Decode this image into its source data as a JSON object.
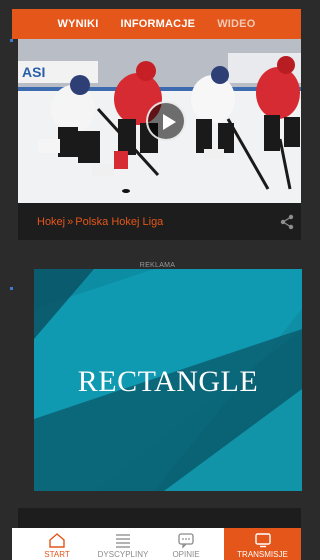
{
  "tabs": [
    "WYNIKI",
    "INFORMACJE",
    "WIDEO"
  ],
  "video": {
    "breadcrumb_sport": "Hokej",
    "breadcrumb_sep": "»",
    "breadcrumb_league": "Polska Hokej Liga"
  },
  "ad": {
    "label": "REKLAMA",
    "text": "RECTANGLE"
  },
  "nav": {
    "start": "START",
    "dyscypliny": "DYSCYPLINY",
    "opinie": "OPINIE",
    "transmisje": "TRANSMISJE"
  },
  "colors": {
    "accent": "#e4561a",
    "background": "#2b2b2b",
    "ad_teal": "#0b6f84"
  },
  "icons": [
    "play-icon",
    "share-icon",
    "home-icon",
    "list-icon",
    "chat-icon",
    "screen-icon"
  ]
}
